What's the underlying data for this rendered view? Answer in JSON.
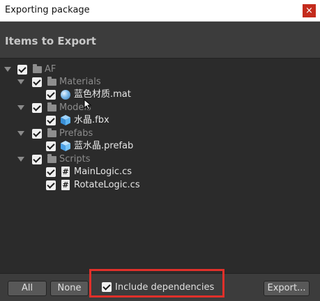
{
  "window": {
    "title": "Exporting package",
    "close_glyph": "×"
  },
  "header": {
    "title": "Items to Export"
  },
  "tree": {
    "root": {
      "label": "AF",
      "checked": true,
      "expanded": true,
      "icon": "folder-icon"
    },
    "folders": [
      {
        "label": "Materials",
        "checked": true,
        "expanded": true,
        "icon": "folder-icon",
        "items": [
          {
            "label": "蓝色材质.mat",
            "checked": true,
            "icon": "material-icon"
          }
        ]
      },
      {
        "label": "Models",
        "checked": true,
        "expanded": true,
        "icon": "folder-icon",
        "items": [
          {
            "label": "水晶.fbx",
            "checked": true,
            "icon": "model-cube-icon"
          }
        ]
      },
      {
        "label": "Prefabs",
        "checked": true,
        "expanded": true,
        "icon": "folder-icon",
        "items": [
          {
            "label": "蓝水晶.prefab",
            "checked": true,
            "icon": "prefab-cube-icon"
          }
        ]
      },
      {
        "label": "Scripts",
        "checked": true,
        "expanded": true,
        "icon": "folder-icon",
        "items": [
          {
            "label": "MainLogic.cs",
            "checked": true,
            "icon": "csharp-script-icon"
          },
          {
            "label": "RotateLogic.cs",
            "checked": true,
            "icon": "csharp-script-icon"
          }
        ]
      }
    ]
  },
  "footer": {
    "all_label": "All",
    "none_label": "None",
    "include_dependencies_label": "Include dependencies",
    "include_dependencies_checked": true,
    "export_label": "Export..."
  },
  "colors": {
    "background": "#2b2b2b",
    "header": "#3c3c3c",
    "highlight_box": "#e0302a",
    "close_button": "#c42b1c"
  }
}
